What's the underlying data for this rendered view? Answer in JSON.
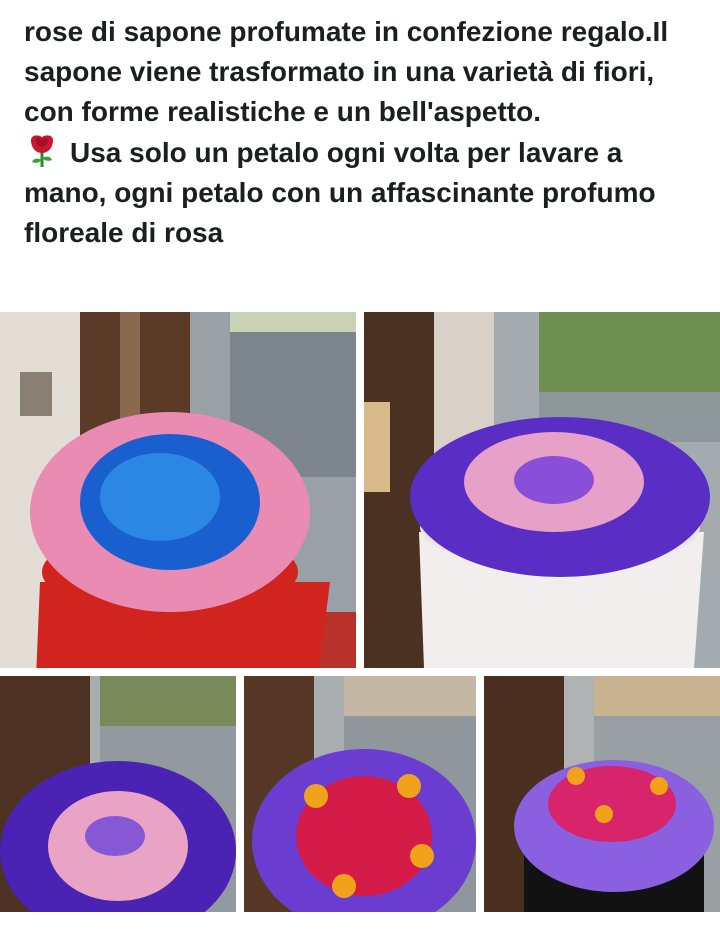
{
  "post": {
    "paragraph1": "rose di sapone profumate in confezione regalo.Il sapone viene trasformato in una varietà di fiori, con forme realistiche e un bell'aspetto.",
    "paragraph2": "Usa solo un petalo ogni volta per lavare a mano, ogni petalo con un affascinante profumo floreale di rosa",
    "paragraph2_icon": "rose-emoji-icon"
  },
  "photos": [
    {
      "subject": "red gift box with pink and blue soap roses"
    },
    {
      "subject": "white gift box with purple and pink soap roses"
    },
    {
      "subject": "purple and pink soap roses"
    },
    {
      "subject": "purple and red soap roses with sunflowers"
    },
    {
      "subject": "black gift box with purple, pink soap roses and sunflowers"
    }
  ],
  "colors": {
    "text": "#1c1e21",
    "pink_rose": "#f2a3c3",
    "blue_rose": "#1e6fd9",
    "purple_rose": "#5b2fc0",
    "red_rose": "#d81e4a",
    "sunflower": "#f1a21c"
  }
}
